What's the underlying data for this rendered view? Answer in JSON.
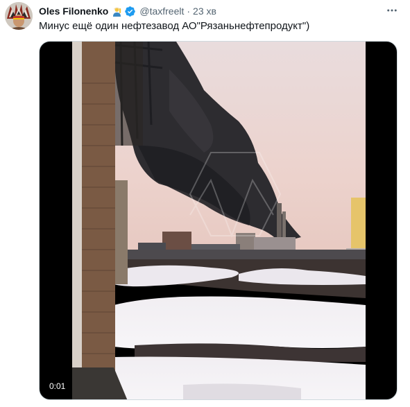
{
  "tweet": {
    "author_name": "Oles Filonenko",
    "author_emoji": "person-raising-hand-emoji",
    "verified_badge": "verified-badge-icon",
    "handle": "@taxfreelt",
    "separator": "·",
    "time": "23 хв",
    "text": "Минус ещё один нефтезавод АО\"Рязаньнефтепродукт\")",
    "more_icon": "more-dots-icon"
  },
  "video": {
    "timestamp": "0:01"
  },
  "colors": {
    "verified_blue": "#1d9bf0",
    "text_primary": "#0f1419",
    "text_secondary": "#536471",
    "smoke": "#2b2b2e",
    "sky": "#e8d4d0"
  }
}
